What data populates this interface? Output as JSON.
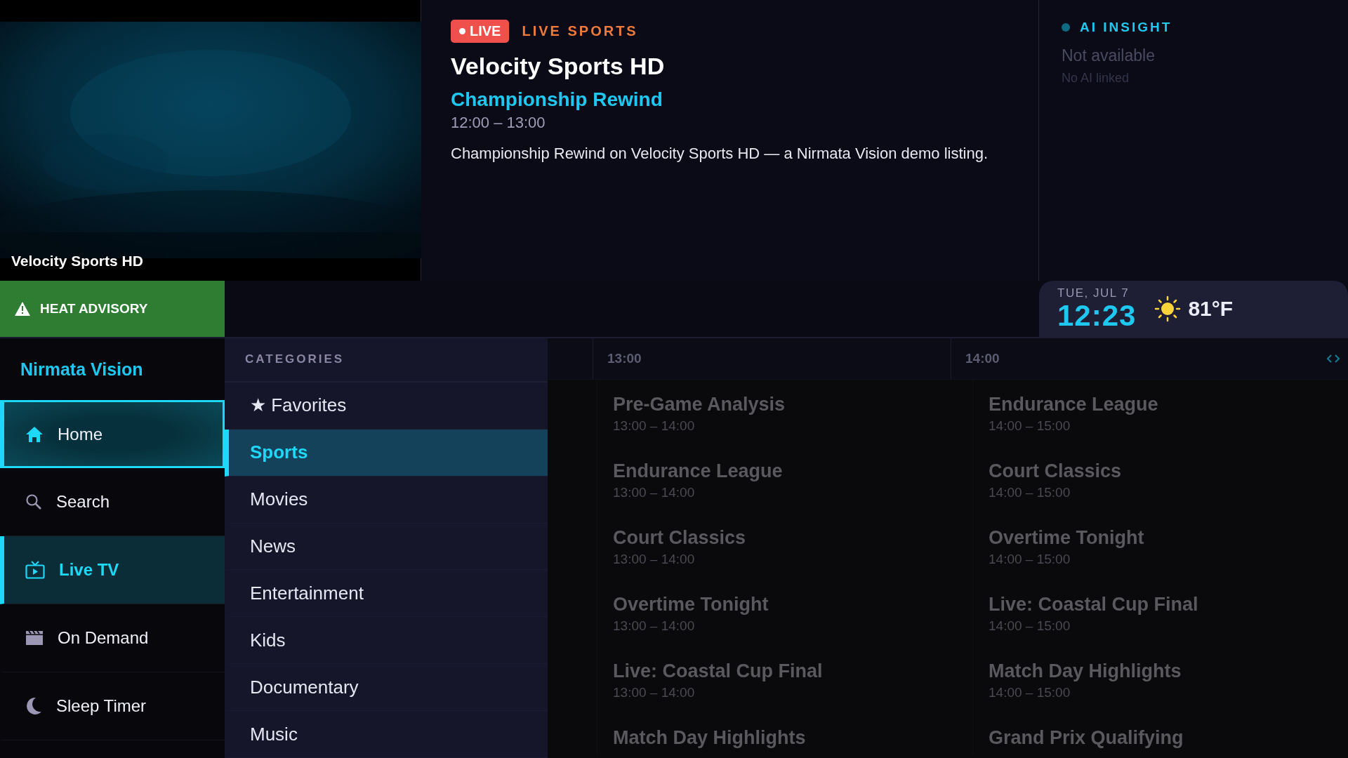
{
  "video": {
    "kind": "picture",
    "caption": "Velocity Sports HD"
  },
  "now_playing": {
    "live_badge": "LIVE",
    "genre": "LIVE SPORTS",
    "channel": "Velocity Sports HD",
    "program": "Championship Rewind",
    "time": "12:00 – 13:00",
    "description": "Championship Rewind on Velocity Sports HD — a Nirmata Vision demo listing."
  },
  "ai_insight": {
    "title": "AI INSIGHT",
    "status": "Not available",
    "detail": "No AI linked"
  },
  "alert": {
    "text": "HEAT ADVISORY"
  },
  "clock": {
    "date": "TUE, JUL 7",
    "time": "12:23",
    "temperature": "81°F"
  },
  "brand": "Nirmata Vision",
  "nav": [
    {
      "label": "Home",
      "kind": "home",
      "focused": true,
      "selected": false
    },
    {
      "label": "Search",
      "kind": "search",
      "focused": false,
      "selected": false
    },
    {
      "label": "Live TV",
      "kind": "tv",
      "focused": false,
      "selected": true
    },
    {
      "label": "On Demand",
      "kind": "clapper",
      "focused": false,
      "selected": false
    },
    {
      "label": "Sleep Timer",
      "kind": "moon",
      "focused": false,
      "selected": false
    }
  ],
  "categories": {
    "title": "CATEGORIES",
    "items": [
      {
        "label": "★ Favorites",
        "selected": false
      },
      {
        "label": "Sports",
        "selected": true
      },
      {
        "label": "Movies",
        "selected": false
      },
      {
        "label": "News",
        "selected": false
      },
      {
        "label": "Entertainment",
        "selected": false
      },
      {
        "label": "Kids",
        "selected": false
      },
      {
        "label": "Documentary",
        "selected": false
      },
      {
        "label": "Music",
        "selected": false
      }
    ]
  },
  "guide": {
    "times": [
      "13:00",
      "14:00"
    ],
    "rows": [
      [
        {
          "title": "Pre-Game Analysis",
          "time": "13:00 – 14:00"
        },
        {
          "title": "Endurance League",
          "time": "14:00 – 15:00"
        }
      ],
      [
        {
          "title": "Endurance League",
          "time": "13:00 – 14:00"
        },
        {
          "title": "Court Classics",
          "time": "14:00 – 15:00"
        }
      ],
      [
        {
          "title": "Court Classics",
          "time": "13:00 – 14:00"
        },
        {
          "title": "Overtime Tonight",
          "time": "14:00 – 15:00"
        }
      ],
      [
        {
          "title": "Overtime Tonight",
          "time": "13:00 – 14:00"
        },
        {
          "title": "Live: Coastal Cup Final",
          "time": "14:00 – 15:00"
        }
      ],
      [
        {
          "title": "Live: Coastal Cup Final",
          "time": "13:00 – 14:00"
        },
        {
          "title": "Match Day Highlights",
          "time": "14:00 – 15:00"
        }
      ],
      [
        {
          "title": "Match Day Highlights"
        },
        {
          "title": "Grand Prix Qualifying"
        }
      ]
    ]
  }
}
